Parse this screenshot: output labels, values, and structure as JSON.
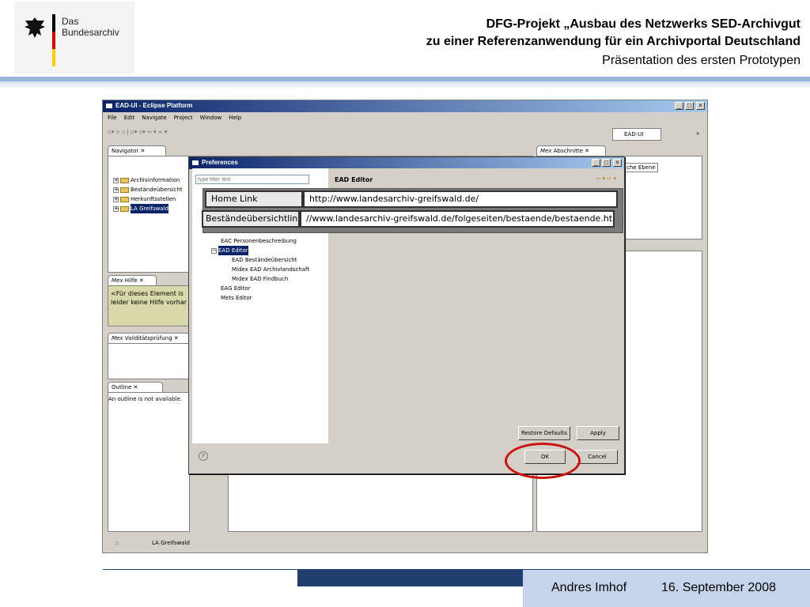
{
  "header": {
    "logo_line1": "Das",
    "logo_line2": "Bundesarchiv",
    "title_line1": "DFG-Projekt „Ausbau des Netzwerks SED-Archivgut",
    "title_line2": "zu einer Referenzanwendung für ein Archivportal Deutschland",
    "title_line3": "Präsentation des ersten Prototypen",
    "flag_colors": [
      "#000000",
      "#dd0000",
      "#ffce00"
    ]
  },
  "footer": {
    "author": "Andres Imhof",
    "date": "16. September 2008"
  },
  "eclipse": {
    "title": "EAD-UI - Eclipse Platform",
    "menu": [
      "File",
      "Edit",
      "Navigate",
      "Project",
      "Window",
      "Help"
    ],
    "perspective": "EAD-UI",
    "navigator": {
      "tab": "Navigator",
      "items": [
        "Archivinformation",
        "Beständeübersicht",
        "Herkunftsstellen",
        "LA Greifswald"
      ]
    },
    "hilfe": {
      "tab": "Hilfe",
      "text1": "<Für dieses Element is",
      "text2": "leider keine Hilfe vorhar"
    },
    "valid": {
      "tab": "Validitätsprüfung"
    },
    "outline": {
      "tab": "Outline",
      "text": "An outline is not available."
    },
    "abschnitte": {
      "tab": "Abschnitte",
      "subtab": "che Ebene"
    },
    "status": "LA Greifswald",
    "mex": "Mex"
  },
  "prefs": {
    "title": "Preferences",
    "filter_placeholder": "type filter text",
    "tree": [
      "EAC Personenbeschreibung",
      "EAD Editor",
      "EAD Beständeübersicht",
      "Midex EAD Archivlandschaft",
      "Midex EAD Findbuch",
      "EAG Editor",
      "Mets Editor"
    ],
    "heading": "EAD Editor",
    "restore": "Restore Defaults",
    "apply": "Apply",
    "ok": "OK",
    "cancel": "Cancel",
    "help": "?"
  },
  "zoom": {
    "home_label": "Home Link",
    "home_value": "http://www.landesarchiv-greifswald.de/",
    "best_label": "Beständeübersichtlink",
    "best_value": "//www.landesarchiv-greifswald.de/folgeseiten/bestaende/bestaende.html"
  }
}
